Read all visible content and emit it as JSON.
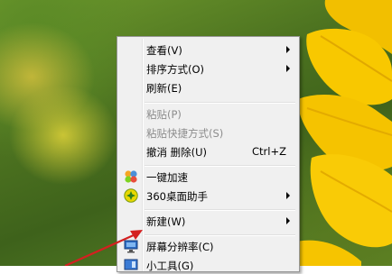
{
  "context_menu": {
    "items": [
      {
        "label": "查看(V)",
        "submenu": true
      },
      {
        "label": "排序方式(O)",
        "submenu": true
      },
      {
        "label": "刷新(E)"
      },
      {
        "label": "粘贴(P)",
        "disabled": true
      },
      {
        "label": "粘贴快捷方式(S)",
        "disabled": true
      },
      {
        "label": "撤消 删除(U)",
        "shortcut": "Ctrl+Z"
      },
      {
        "label": "一键加速",
        "icon": "speedup-icon"
      },
      {
        "label": "360桌面助手",
        "icon": "360-desktop-assistant-icon",
        "submenu": true
      },
      {
        "label": "新建(W)",
        "submenu": true
      },
      {
        "label": "屏幕分辨率(C)",
        "icon": "screen-resolution-icon"
      },
      {
        "label": "小工具(G)",
        "icon": "gadgets-icon"
      }
    ]
  },
  "colors": {
    "annotation_arrow": "#d42020",
    "menu_background": "#f0f0f0",
    "flower": "#f7c600"
  }
}
